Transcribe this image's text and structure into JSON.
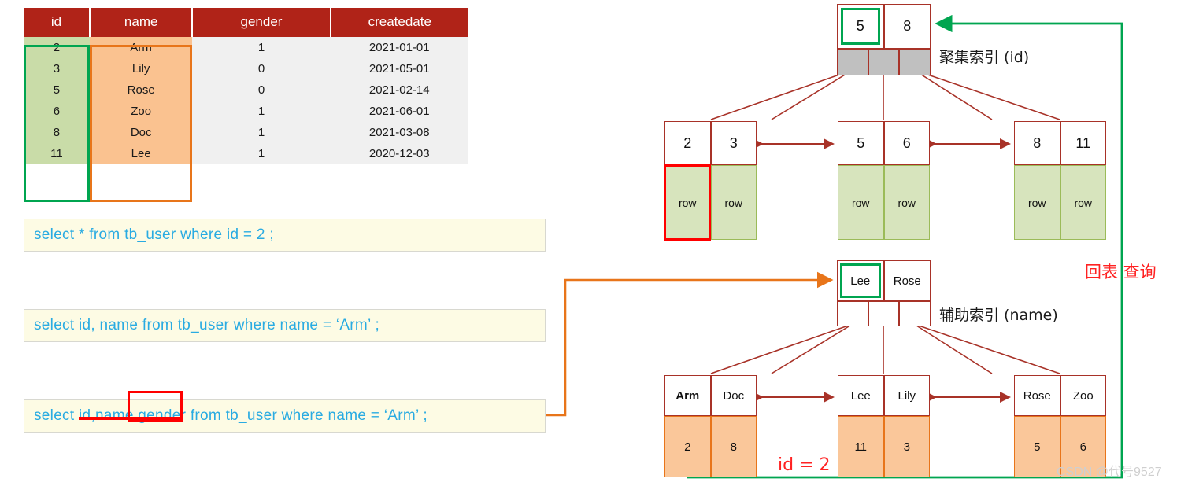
{
  "table": {
    "columns": [
      "id",
      "name",
      "gender",
      "createdate"
    ],
    "rows": [
      {
        "id": "2",
        "name": "Arm",
        "gender": "1",
        "createdate": "2021-01-01"
      },
      {
        "id": "3",
        "name": "Lily",
        "gender": "0",
        "createdate": "2021-05-01"
      },
      {
        "id": "5",
        "name": "Rose",
        "gender": "0",
        "createdate": "2021-02-14"
      },
      {
        "id": "6",
        "name": "Zoo",
        "gender": "1",
        "createdate": "2021-06-01"
      },
      {
        "id": "8",
        "name": "Doc",
        "gender": "1",
        "createdate": "2021-03-08"
      },
      {
        "id": "11",
        "name": "Lee",
        "gender": "1",
        "createdate": "2020-12-03"
      }
    ],
    "header_color": "#b02318",
    "id_col_color": "#c9dca8",
    "name_col_color": "#fac290",
    "id_highlight_color": "#00a550",
    "name_highlight_color": "#e8751a"
  },
  "queries": [
    {
      "id": "sql-1",
      "text": "select  *  from  tb_user  where  id  =  2 ;"
    },
    {
      "id": "sql-2",
      "text": "select  id, name  from  tb_user  where  name = ‘Arm’ ;"
    },
    {
      "id": "sql-3",
      "text": "select  id,name,gender  from  tb_user  where  name = ‘Arm’ ;"
    }
  ],
  "clustered_index": {
    "label": "聚集索引 (id)",
    "root": {
      "keys": [
        "5",
        "8"
      ],
      "highlighted_key": "5",
      "pointer_count": 3,
      "pointer_fill": "gray"
    },
    "leaves": [
      {
        "keys": [
          "2",
          "3"
        ],
        "data": [
          "row",
          "row"
        ]
      },
      {
        "keys": [
          "5",
          "6"
        ],
        "data": [
          "row",
          "row"
        ]
      },
      {
        "keys": [
          "8",
          "11"
        ],
        "data": [
          "row",
          "row"
        ]
      }
    ],
    "leaf_fill": "#d7e4bd",
    "highlighted_leaf_cell": "2"
  },
  "secondary_index": {
    "label": "辅助索引 (name)",
    "root": {
      "keys": [
        "Lee",
        "Rose"
      ],
      "highlighted_key": "Lee",
      "pointer_count": 3,
      "pointer_fill": "white"
    },
    "leaves": [
      {
        "keys": [
          "Arm",
          "Doc"
        ],
        "data": [
          "2",
          "8"
        ],
        "bold_key": "Arm"
      },
      {
        "keys": [
          "Lee",
          "Lily"
        ],
        "data": [
          "11",
          "3"
        ],
        "bold_key": ""
      },
      {
        "keys": [
          "Rose",
          "Zoo"
        ],
        "data": [
          "5",
          "6"
        ],
        "bold_key": ""
      }
    ],
    "leaf_fill": "#fac79a"
  },
  "annotations": {
    "back_to_table": "回表  查询",
    "id_equals": "id = 2",
    "back_to_table_color": "#ff2222",
    "green_path_color": "#00a550",
    "orange_path_color": "#e8751a",
    "tree_line_color": "#a83228"
  },
  "watermark": "CSDN @代号9527"
}
